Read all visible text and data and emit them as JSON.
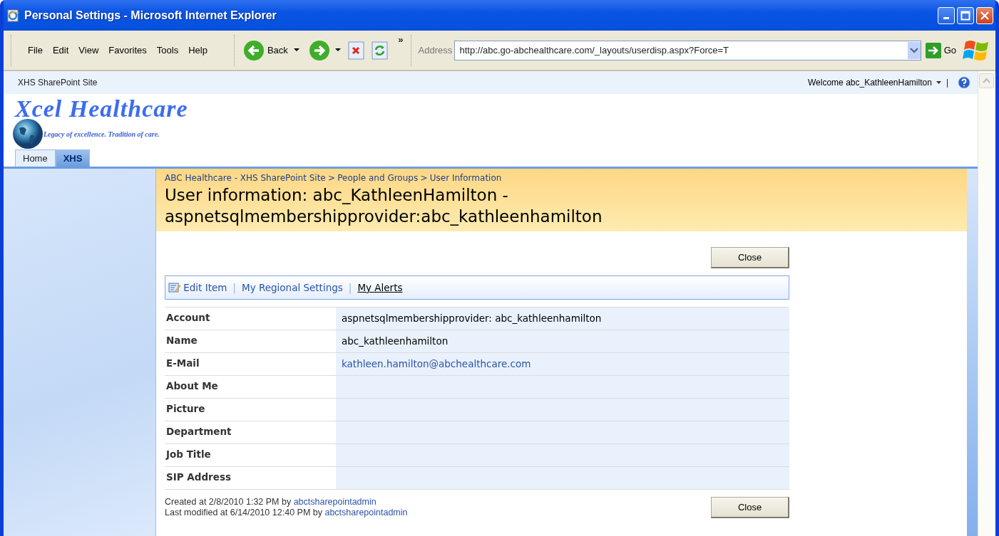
{
  "window": {
    "title": "Personal Settings - Microsoft Internet Explorer"
  },
  "menu": [
    "File",
    "Edit",
    "View",
    "Favorites",
    "Tools",
    "Help"
  ],
  "toolbar": {
    "back": "Back",
    "chevrons": "»",
    "address_label": "Address",
    "address": "http://abc.go-abchealthcare.com/_layouts/userdisp.aspx?Force=T",
    "go": "Go"
  },
  "top_bar": {
    "site_title": "XHS SharePoint Site",
    "welcome": "Welcome abc_KathleenHamilton",
    "separator": "|"
  },
  "logo": {
    "title": "Xcel Healthcare",
    "tagline": "Legacy of excellence. Tradition of care."
  },
  "tabs": [
    {
      "label": "Home",
      "selected": false
    },
    {
      "label": "XHS",
      "selected": true
    }
  ],
  "breadcrumb": {
    "separator": ">",
    "items": [
      "ABC Healthcare - XHS SharePoint Site",
      "People and Groups",
      "User Information"
    ]
  },
  "page_title": "User information: abc_KathleenHamilton - aspnetsqlmembershipprovider:abc_kathleenhamilton",
  "close_button": "Close",
  "actions": {
    "separator": "|",
    "items": [
      {
        "label": "Edit Item",
        "kind": "edit"
      },
      {
        "label": "My Regional Settings",
        "kind": "link"
      },
      {
        "label": "My Alerts",
        "kind": "underlined"
      }
    ]
  },
  "fields": [
    {
      "label": "Account",
      "value": "aspnetsqlmembershipprovider: abc_kathleenhamilton",
      "kind": "text"
    },
    {
      "label": "Name",
      "value": "abc_kathleenhamilton",
      "kind": "text"
    },
    {
      "label": "E-Mail",
      "value": "kathleen.hamilton@abchealthcare.com",
      "kind": "link"
    },
    {
      "label": "About Me",
      "kind": "empty"
    },
    {
      "label": "Picture",
      "kind": "empty"
    },
    {
      "label": "Department",
      "kind": "empty"
    },
    {
      "label": "Job Title",
      "kind": "empty"
    },
    {
      "label": "SIP Address",
      "kind": "empty"
    }
  ],
  "footer": [
    {
      "text": "Created at 2/8/2010 1:32 PM  by",
      "user": "abctsharepointadmin"
    },
    {
      "text": "Last modified at 6/14/2010 12:40 PM  by",
      "user": "abctsharepointadmin"
    }
  ],
  "footer_button": "Close"
}
